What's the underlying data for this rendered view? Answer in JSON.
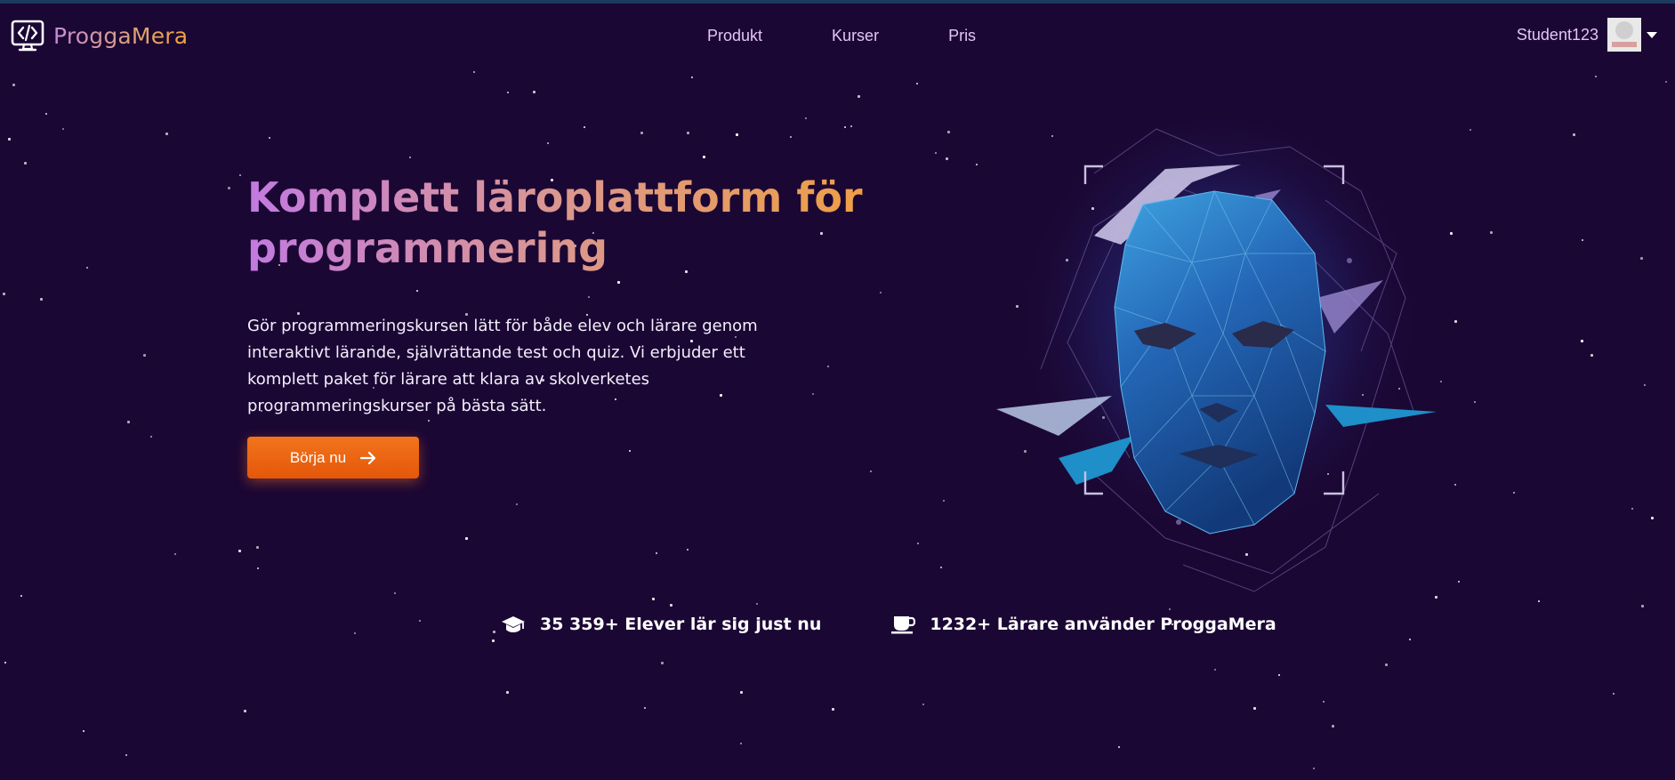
{
  "nav": {
    "brand": "ProggaMera",
    "links": [
      {
        "label": "Produkt"
      },
      {
        "label": "Kurser"
      },
      {
        "label": "Pris"
      }
    ],
    "user": {
      "name": "Student123"
    }
  },
  "hero": {
    "title": "Komplett läroplattform för programmering",
    "text": "Gör programmeringskursen lätt för både elev och lärare genom interaktivt lärande, självrättande test och quiz. Vi erbjuder ett komplett paket för lärare att klara av skolverketes programmeringskurser på bästa sätt.",
    "cta_label": "Börja nu"
  },
  "stats": [
    {
      "icon": "graduation-cap-icon",
      "text": "35 359+ Elever lär sig just nu"
    },
    {
      "icon": "coffee-cup-icon",
      "text": "1232+ Lärare använder ProggaMera"
    }
  ],
  "colors": {
    "background": "#1b0734",
    "accent": "#f06a14",
    "nav_text": "#e3c4f6",
    "title_gradient_start": "#c27ae0",
    "title_gradient_end": "#f0a040"
  }
}
